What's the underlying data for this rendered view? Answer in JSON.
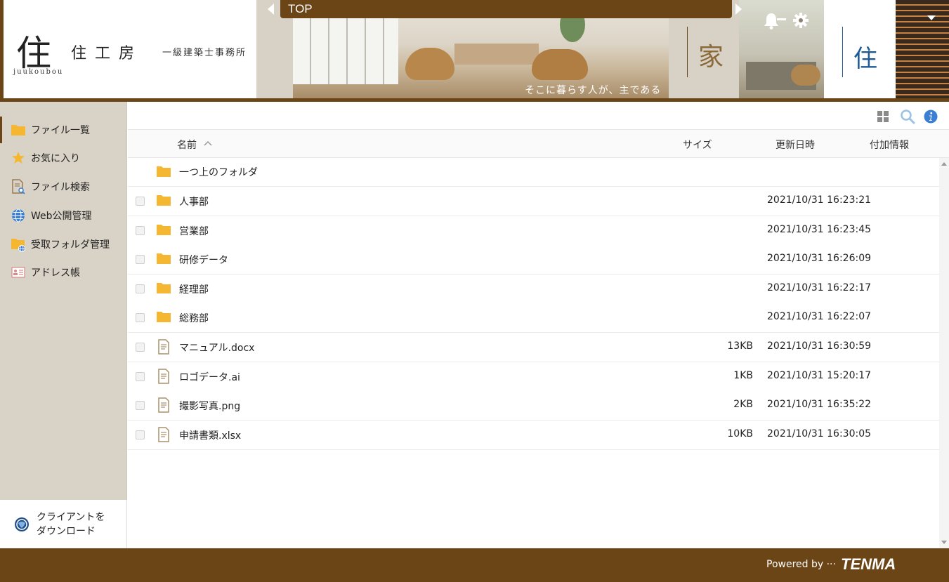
{
  "header": {
    "logo": {
      "mark": "住",
      "name": "住工房",
      "subtitle": "一級建築士事務所",
      "roman": "juukoubou"
    },
    "banner": {
      "caption": "そこに暮らす人が、主であること",
      "kanji_left": "家",
      "kanji_right": "住"
    },
    "breadcrumb": "TOP",
    "icons": [
      "bell-icon",
      "gear-icon",
      "chevron-down-icon"
    ]
  },
  "sidebar": {
    "items": [
      {
        "label": "ファイル一覧",
        "icon": "folder-icon"
      },
      {
        "label": "お気に入り",
        "icon": "star-icon"
      },
      {
        "label": "ファイル検索",
        "icon": "file-search-icon"
      },
      {
        "label": "Web公開管理",
        "icon": "globe-icon"
      },
      {
        "label": "受取フォルダ管理",
        "icon": "receive-folder-icon"
      },
      {
        "label": "アドレス帳",
        "icon": "address-card-icon"
      }
    ],
    "download": {
      "line1": "クライアントを",
      "line2": "ダウンロード"
    }
  },
  "toolbar": {
    "icons": [
      "grid-icon",
      "search-icon",
      "info-icon"
    ]
  },
  "list": {
    "columns": {
      "name": "名前",
      "size": "サイズ",
      "date": "更新日時",
      "info": "付加情報"
    },
    "parent": "一つ上のフォルダ",
    "rows": [
      {
        "type": "folder",
        "name": "人事部",
        "size": "",
        "date": "2021/10/31 16:23:21"
      },
      {
        "type": "folder",
        "name": "営業部",
        "size": "",
        "date": "2021/10/31 16:23:45"
      },
      {
        "type": "folder",
        "name": "研修データ",
        "size": "",
        "date": "2021/10/31 16:26:09"
      },
      {
        "type": "folder",
        "name": "経理部",
        "size": "",
        "date": "2021/10/31 16:22:17"
      },
      {
        "type": "folder",
        "name": "総務部",
        "size": "",
        "date": "2021/10/31 16:22:07"
      },
      {
        "type": "file",
        "name": "マニュアル.docx",
        "size": "13KB",
        "date": "2021/10/31 16:30:59"
      },
      {
        "type": "file",
        "name": "ロゴデータ.ai",
        "size": "1KB",
        "date": "2021/10/31 15:20:17"
      },
      {
        "type": "file",
        "name": "撮影写真.png",
        "size": "2KB",
        "date": "2021/10/31 16:35:22"
      },
      {
        "type": "file",
        "name": "申請書類.xlsx",
        "size": "10KB",
        "date": "2021/10/31 16:30:05"
      }
    ]
  },
  "footer": {
    "powered": "Powered by ···",
    "brand": "TENMA"
  },
  "colors": {
    "brand_brown": "#6b4516",
    "sidebar_bg": "#d9d3c7",
    "folder": "#f5b731",
    "info_blue": "#3b7fd4",
    "kanji_blue": "#1e5a96"
  }
}
